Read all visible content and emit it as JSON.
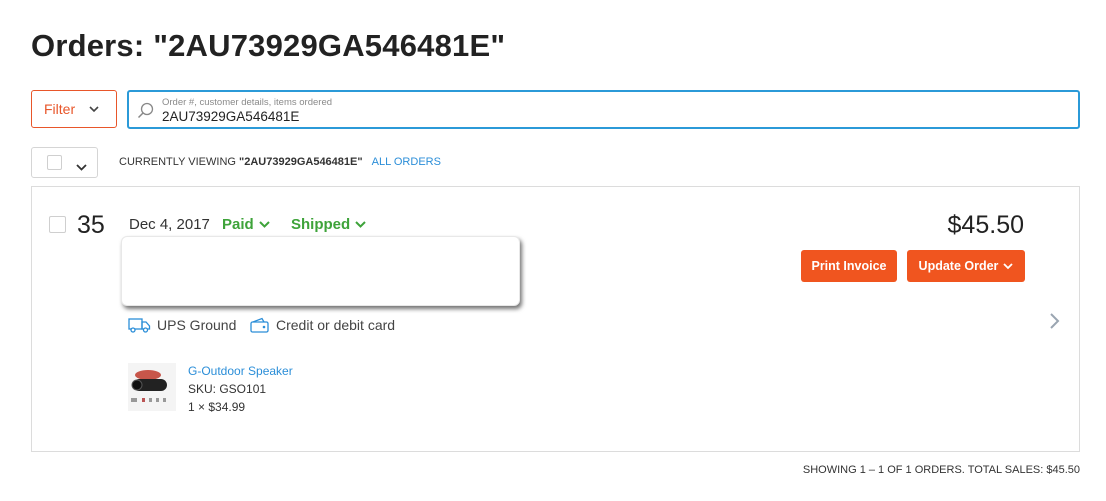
{
  "page_title": "Orders: \"2AU73929GA546481E\"",
  "filter": {
    "label": "Filter"
  },
  "search": {
    "placeholder": "Order #, customer details, items ordered",
    "value": "2AU73929GA546481E"
  },
  "viewing": {
    "prefix": "CURRENTLY VIEWING",
    "query": "\"2AU73929GA546481E\"",
    "all_orders_link": "ALL ORDERS"
  },
  "order": {
    "number": "35",
    "date": "Dec 4, 2017",
    "payment_status": "Paid",
    "fulfillment_status": "Shipped",
    "total": "$45.50",
    "print_invoice_label": "Print Invoice",
    "update_order_label": "Update Order",
    "shipping_method": "UPS Ground",
    "payment_method": "Credit or debit card",
    "items": [
      {
        "name": "G-Outdoor Speaker",
        "sku": "SKU: GSO101",
        "qty_price": "1 × $34.99"
      }
    ]
  },
  "summary": "SHOWING 1 – 1 OF 1 ORDERS. TOTAL SALES: $45.50",
  "colors": {
    "accent": "#f0551f",
    "link": "#2b8ed8",
    "status_green": "#3ea33a",
    "focus_border": "#2b9ad8"
  },
  "icons": {
    "search": "magnifier-icon",
    "shipping": "truck-icon",
    "payment": "wallet-icon",
    "chevron": "chevron-down-icon",
    "next": "chevron-right-icon"
  }
}
